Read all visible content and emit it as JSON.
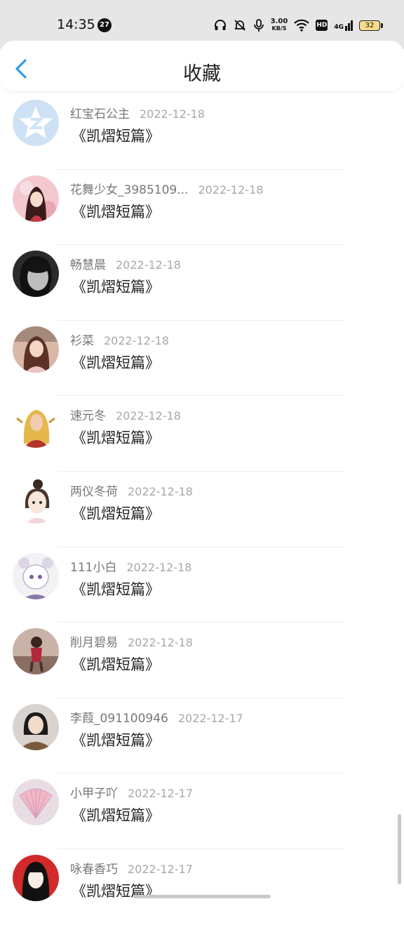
{
  "status_bar": {
    "time": "14:35",
    "badge": "27",
    "speed_top": "3.00",
    "speed_unit": "KB/S",
    "hd": "HD",
    "network": "4G",
    "battery": "32",
    "icons": [
      "headphones-icon",
      "mute-icon",
      "mic-icon",
      "wifi-icon",
      "hd-icon",
      "signal-icon",
      "battery-icon"
    ]
  },
  "header": {
    "title": "收藏",
    "back_icon": "chevron-left-icon",
    "accent": "#2f9bea"
  },
  "items": [
    {
      "name": "红宝石公主",
      "date": "2022-12-18",
      "work": "《凯熠短篇》"
    },
    {
      "name": "花舞少女_3985109...",
      "date": "2022-12-18",
      "work": "《凯熠短篇》"
    },
    {
      "name": "畅慧晨",
      "date": "2022-12-18",
      "work": "《凯熠短篇》"
    },
    {
      "name": "衫菜",
      "date": "2022-12-18",
      "work": "《凯熠短篇》"
    },
    {
      "name": "速元冬",
      "date": "2022-12-18",
      "work": "《凯熠短篇》"
    },
    {
      "name": "两仪冬荷",
      "date": "2022-12-18",
      "work": "《凯熠短篇》"
    },
    {
      "name": "111小白",
      "date": "2022-12-18",
      "work": "《凯熠短篇》"
    },
    {
      "name": "削月碧易",
      "date": "2022-12-18",
      "work": "《凯熠短篇》"
    },
    {
      "name": "李葭_091100946",
      "date": "2022-12-17",
      "work": "《凯熠短篇》"
    },
    {
      "name": "小甲子吖",
      "date": "2022-12-17",
      "work": "《凯熠短篇》"
    },
    {
      "name": "咏春香巧",
      "date": "2022-12-17",
      "work": "《凯熠短篇》"
    }
  ]
}
